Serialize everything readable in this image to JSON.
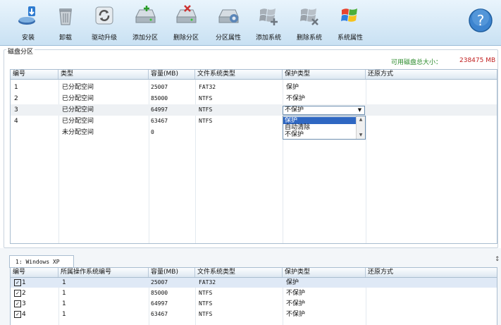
{
  "toolbar": {
    "items": [
      {
        "label": "安装",
        "icon": "install-icon"
      },
      {
        "label": "卸载",
        "icon": "trash-icon"
      },
      {
        "label": "驱动升级",
        "icon": "refresh-icon"
      },
      {
        "label": "添加分区",
        "icon": "disk-add-icon"
      },
      {
        "label": "删除分区",
        "icon": "disk-delete-icon"
      },
      {
        "label": "分区属性",
        "icon": "disk-gear-icon"
      },
      {
        "label": "添加系统",
        "icon": "windows-add-icon"
      },
      {
        "label": "删除系统",
        "icon": "windows-delete-icon"
      },
      {
        "label": "系统属性",
        "icon": "windows-flag-icon"
      }
    ],
    "help_label": "?"
  },
  "partitions": {
    "title": "磁盘分区",
    "free_label": "可用磁盘总大小：",
    "free_value": "238475 MB",
    "columns": [
      "编号",
      "类型",
      "容量(MB)",
      "文件系统类型",
      "保护类型",
      "还原方式"
    ],
    "rows": [
      {
        "id": "1",
        "type": "已分配空间",
        "size": "25007",
        "fs": "FAT32",
        "protect": "保护",
        "restore": ""
      },
      {
        "id": "2",
        "type": "已分配空间",
        "size": "85000",
        "fs": "NTFS",
        "protect": "不保护",
        "restore": ""
      },
      {
        "id": "3",
        "type": "已分配空间",
        "size": "64997",
        "fs": "NTFS",
        "protect": "",
        "restore": ""
      },
      {
        "id": "4",
        "type": "已分配空间",
        "size": "63467",
        "fs": "NTFS",
        "protect": "",
        "restore": ""
      },
      {
        "id": "",
        "type": "未分配空间",
        "size": "0",
        "fs": "",
        "protect": "",
        "restore": ""
      }
    ],
    "dropdown": {
      "value": "不保护",
      "options": [
        "保护",
        "自动清除",
        "不保护"
      ],
      "highlighted": 0
    }
  },
  "systems": {
    "tab_label": "1: Windows XP",
    "columns": [
      "编号",
      "所属操作系统编号",
      "容量(MB)",
      "文件系统类型",
      "保护类型",
      "还原方式"
    ],
    "rows": [
      {
        "id": "1",
        "os": "1",
        "size": "25007",
        "fs": "FAT32",
        "protect": "保护",
        "restore": ""
      },
      {
        "id": "2",
        "os": "1",
        "size": "85000",
        "fs": "NTFS",
        "protect": "不保护",
        "restore": ""
      },
      {
        "id": "3",
        "os": "1",
        "size": "64997",
        "fs": "NTFS",
        "protect": "不保护",
        "restore": ""
      },
      {
        "id": "4",
        "os": "1",
        "size": "63467",
        "fs": "NTFS",
        "protect": "不保护",
        "restore": ""
      }
    ]
  }
}
